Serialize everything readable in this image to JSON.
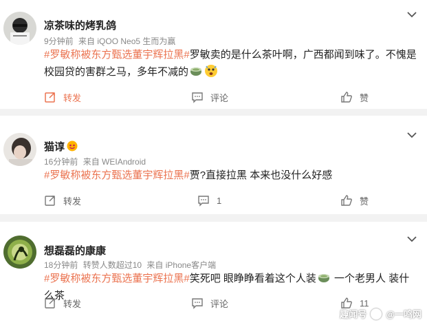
{
  "posts": [
    {
      "author": "凉茶味的烤乳鸽",
      "time": "9分钟前",
      "source": "来自 iQOO Neo5 生而为赢",
      "reposts_note": "",
      "tag": "#罗敏称被东方甄选董宇辉拉黑#",
      "text_a": "罗敏卖的是什么茶叶啊，广西都闻到味了。不愧是校园贷的害群之马，多年不减的",
      "text_b": "",
      "emojis": [
        "tea-cup-emoji",
        "scared-face-emoji"
      ],
      "actions": {
        "repost": "转发",
        "comment": "评论",
        "like": "赞"
      }
    },
    {
      "author": "猫谆",
      "time": "16分钟前",
      "source": "来自 WEIAndroid",
      "tag": "#罗敏称被东方甄选董宇辉拉黑#",
      "text_a": "贾?直接拉黑 本来也没什么好感",
      "actions": {
        "repost": "转发",
        "comment": "1",
        "like": "赞"
      }
    },
    {
      "author": "想磊磊的康康",
      "time": "18分钟前",
      "reposts_note": "转赞人数超过10",
      "source": "来自 iPhone客户端",
      "tag": "#罗敏称被东方甄选董宇辉拉黑#",
      "text_a": "笑死吧 眼睁睁看着这个人装",
      "text_b": " 一个老男人 装什么茶",
      "actions": {
        "repost": "转发",
        "comment": "评论",
        "like": "11"
      }
    }
  ],
  "watermark": {
    "left": "趣闻号",
    "right": "@一鸣网"
  },
  "colors": {
    "topic": "#eb7350",
    "meta": "#888888",
    "repost_active": "#eb7350"
  }
}
